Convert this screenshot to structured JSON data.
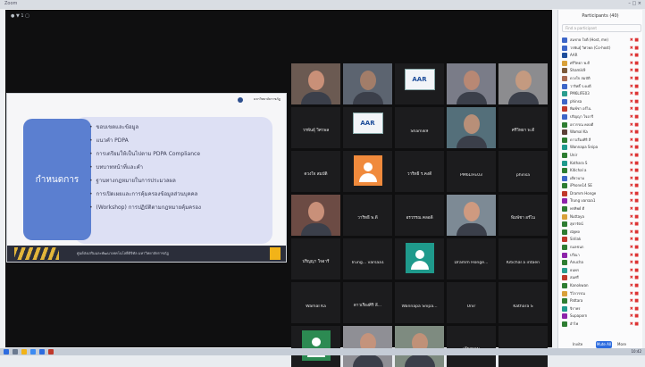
{
  "window": {
    "title": "Zoom",
    "controls": "– □ ×"
  },
  "topbar": {
    "label": "● ▼ 1 ▢"
  },
  "slide": {
    "tag": "กำหนดการ",
    "logo_text": "มหาวิทยาลัยราชภัฏ",
    "items": [
      "ขอบเขตและข้อมูล",
      "แนวคำ PDPA",
      "การเตรียมให้เป็นไปตาม PDPA Compliance",
      "บทบาทหน้าที่และคำ",
      "ฐานทางกฎหมายในการประมวลผล",
      "การเปิดเผยและการคุ้มครองข้อมูลส่วนบุคคล",
      "(Workshop) การปฏิบัติตามกฎหมายคุ้มครอง"
    ],
    "footer_text": "ศูนย์ส่งเสริมและพัฒนาเทคโนโลยีดิจิทัล มหาวิทยาลัยราชภัฏ"
  },
  "tiles": [
    {
      "name": "",
      "small": "",
      "kind": "video",
      "bg": "#6b5a52",
      "face": "#c99078"
    },
    {
      "name": "",
      "small": "",
      "kind": "video",
      "bg": "#5c6470",
      "face": "#a27d69"
    },
    {
      "name": "",
      "small": "",
      "kind": "logo",
      "logo": "AAR"
    },
    {
      "name": "",
      "small": "",
      "kind": "video",
      "bg": "#7a7c88",
      "face": "#b88874"
    },
    {
      "name": "",
      "small": "",
      "kind": "video",
      "bg": "#8c8c8f",
      "face": "#c49a80"
    },
    {
      "name": "วรพันธุ์ วิศวพล",
      "small": "",
      "kind": "name"
    },
    {
      "name": "",
      "small": "",
      "kind": "logo",
      "logo": "AAR"
    },
    {
      "name": "Shamik9",
      "small": "",
      "kind": "name"
    },
    {
      "name": "",
      "small": "",
      "kind": "video",
      "bg": "#546f7a",
      "face": "#b88f78"
    },
    {
      "name": "ศรีวิทยา พ.ดี",
      "small": "",
      "kind": "name"
    },
    {
      "name": "ดวงใจ สมบัติ",
      "small": "",
      "kind": "name"
    },
    {
      "name": "",
      "small": "",
      "kind": "avatar",
      "bg": "#f08a3c"
    },
    {
      "name": "วาริทธิ์ ร.คงดี",
      "small": "",
      "kind": "name"
    },
    {
      "name": "PM6LIFE03",
      "small": "",
      "kind": "name"
    },
    {
      "name": "phinsa",
      "small": "",
      "kind": "name"
    },
    {
      "name": "",
      "small": "",
      "kind": "video",
      "bg": "#6c4b44",
      "face": "#c99079"
    },
    {
      "name": "วาริทธิ์ พ.ดี",
      "small": "",
      "kind": "name"
    },
    {
      "name": "อรวรรณ คลอดี",
      "small": "",
      "kind": "name"
    },
    {
      "name": "",
      "small": "",
      "kind": "video",
      "bg": "#7d8a95",
      "face": "#cf9a80"
    },
    {
      "name": "พิมพ์ชา อร์ไน",
      "small": "",
      "kind": "name"
    },
    {
      "name": "ปริญญา ใจอารี",
      "small": "",
      "kind": "name"
    },
    {
      "name": "Trung... varsaa1",
      "small": "",
      "kind": "name"
    },
    {
      "name": "",
      "small": "",
      "kind": "avatar",
      "bg": "#1f9a8c"
    },
    {
      "name": "Dramm Honge...",
      "small": "",
      "kind": "name"
    },
    {
      "name": "Kitichal a intaen",
      "small": "",
      "kind": "name"
    },
    {
      "name": "Wamal Ka",
      "small": "",
      "kind": "name"
    },
    {
      "name": "ดาวเรืองศิริ ลี...",
      "small": "",
      "kind": "name"
    },
    {
      "name": "Wannapa Snipa...",
      "small": "",
      "kind": "name"
    },
    {
      "name": "Unir",
      "small": "",
      "kind": "name"
    },
    {
      "name": "Kathara S",
      "small": "",
      "kind": "name"
    },
    {
      "name": "",
      "small": "",
      "kind": "avatar",
      "bg": "#2c8a52"
    },
    {
      "name": "",
      "small": "",
      "kind": "video",
      "bg": "#8f8f95",
      "face": "#c4937c"
    },
    {
      "name": "",
      "small": "",
      "kind": "video",
      "bg": "#7e8b80",
      "face": "#c09178"
    },
    {
      "name": "เดียวนาม",
      "small": "",
      "kind": "name"
    },
    {
      "name": "iPhone14 SE",
      "small": "",
      "kind": "name"
    }
  ],
  "panel": {
    "title": "Participants (40)",
    "search_placeholder": "Find a participant",
    "participants": [
      {
        "name": "สมชาย ใจดี (Host, me)",
        "color": "#3d66c8"
      },
      {
        "name": "วรพันธุ์ วิศวพล (Co-host)",
        "color": "#3d66c8"
      },
      {
        "name": "AAR",
        "color": "#1f4e9b"
      },
      {
        "name": "ศรีวิทยา พ.ดี",
        "color": "#d9a13a"
      },
      {
        "name": "Shamik9",
        "color": "#7c5a3a"
      },
      {
        "name": "ดวงใจ สมบัติ",
        "color": "#a86a52"
      },
      {
        "name": "วาริทธิ์ ร.คงดี",
        "color": "#3d66c8"
      },
      {
        "name": "PM6LIFE03",
        "color": "#2a9d8f"
      },
      {
        "name": "phinsa",
        "color": "#3d66c8"
      },
      {
        "name": "พิมพ์ชา อร์ไน",
        "color": "#c0392b"
      },
      {
        "name": "ปริญญา ใจอารี",
        "color": "#3d66c8"
      },
      {
        "name": "อรวรรณ คลอดี",
        "color": "#2e7d32"
      },
      {
        "name": "Wamal Ka",
        "color": "#5d4037"
      },
      {
        "name": "ดาวเรืองศิริ ลี",
        "color": "#2e7d32"
      },
      {
        "name": "Wannapa Snipa",
        "color": "#1f9a8c"
      },
      {
        "name": "Unir",
        "color": "#2e7d32"
      },
      {
        "name": "Kathara S",
        "color": "#1f9a8c"
      },
      {
        "name": "Kitichal a",
        "color": "#2e7d32"
      },
      {
        "name": "เดียวนาม",
        "color": "#3d66c8"
      },
      {
        "name": "iPhone14 SE",
        "color": "#2e7d32"
      },
      {
        "name": "Dramm Honge",
        "color": "#c0392b"
      },
      {
        "name": "Trung varsaa1",
        "color": "#8e24aa"
      },
      {
        "name": "พรทิพย์ ดี",
        "color": "#2e7d32"
      },
      {
        "name": "Nuttaya",
        "color": "#d9a13a"
      },
      {
        "name": "สุดารัตน์",
        "color": "#2e7d32"
      },
      {
        "name": "ณัฐพล",
        "color": "#2e7d32"
      },
      {
        "name": "Sirilak",
        "color": "#c0392b"
      },
      {
        "name": "กมลชนก",
        "color": "#2e7d32"
      },
      {
        "name": "ปวีณา",
        "color": "#8e24aa"
      },
      {
        "name": "Anucha",
        "color": "#2e7d32"
      },
      {
        "name": "ธนพร",
        "color": "#2a9d8f"
      },
      {
        "name": "สมศรี",
        "color": "#c0392b"
      },
      {
        "name": "Kanokwan",
        "color": "#2e7d32"
      },
      {
        "name": "วิไลวรรณ",
        "color": "#d9a13a"
      },
      {
        "name": "Pattara",
        "color": "#2e7d32"
      },
      {
        "name": "จิราพร",
        "color": "#1f9a8c"
      },
      {
        "name": "Supaporn",
        "color": "#8e24aa"
      },
      {
        "name": "อำไพ",
        "color": "#2e7d32"
      }
    ],
    "invite": "Invite",
    "mute_all": "Mute All",
    "more": "More"
  },
  "taskbar": {
    "time": "10:42"
  }
}
